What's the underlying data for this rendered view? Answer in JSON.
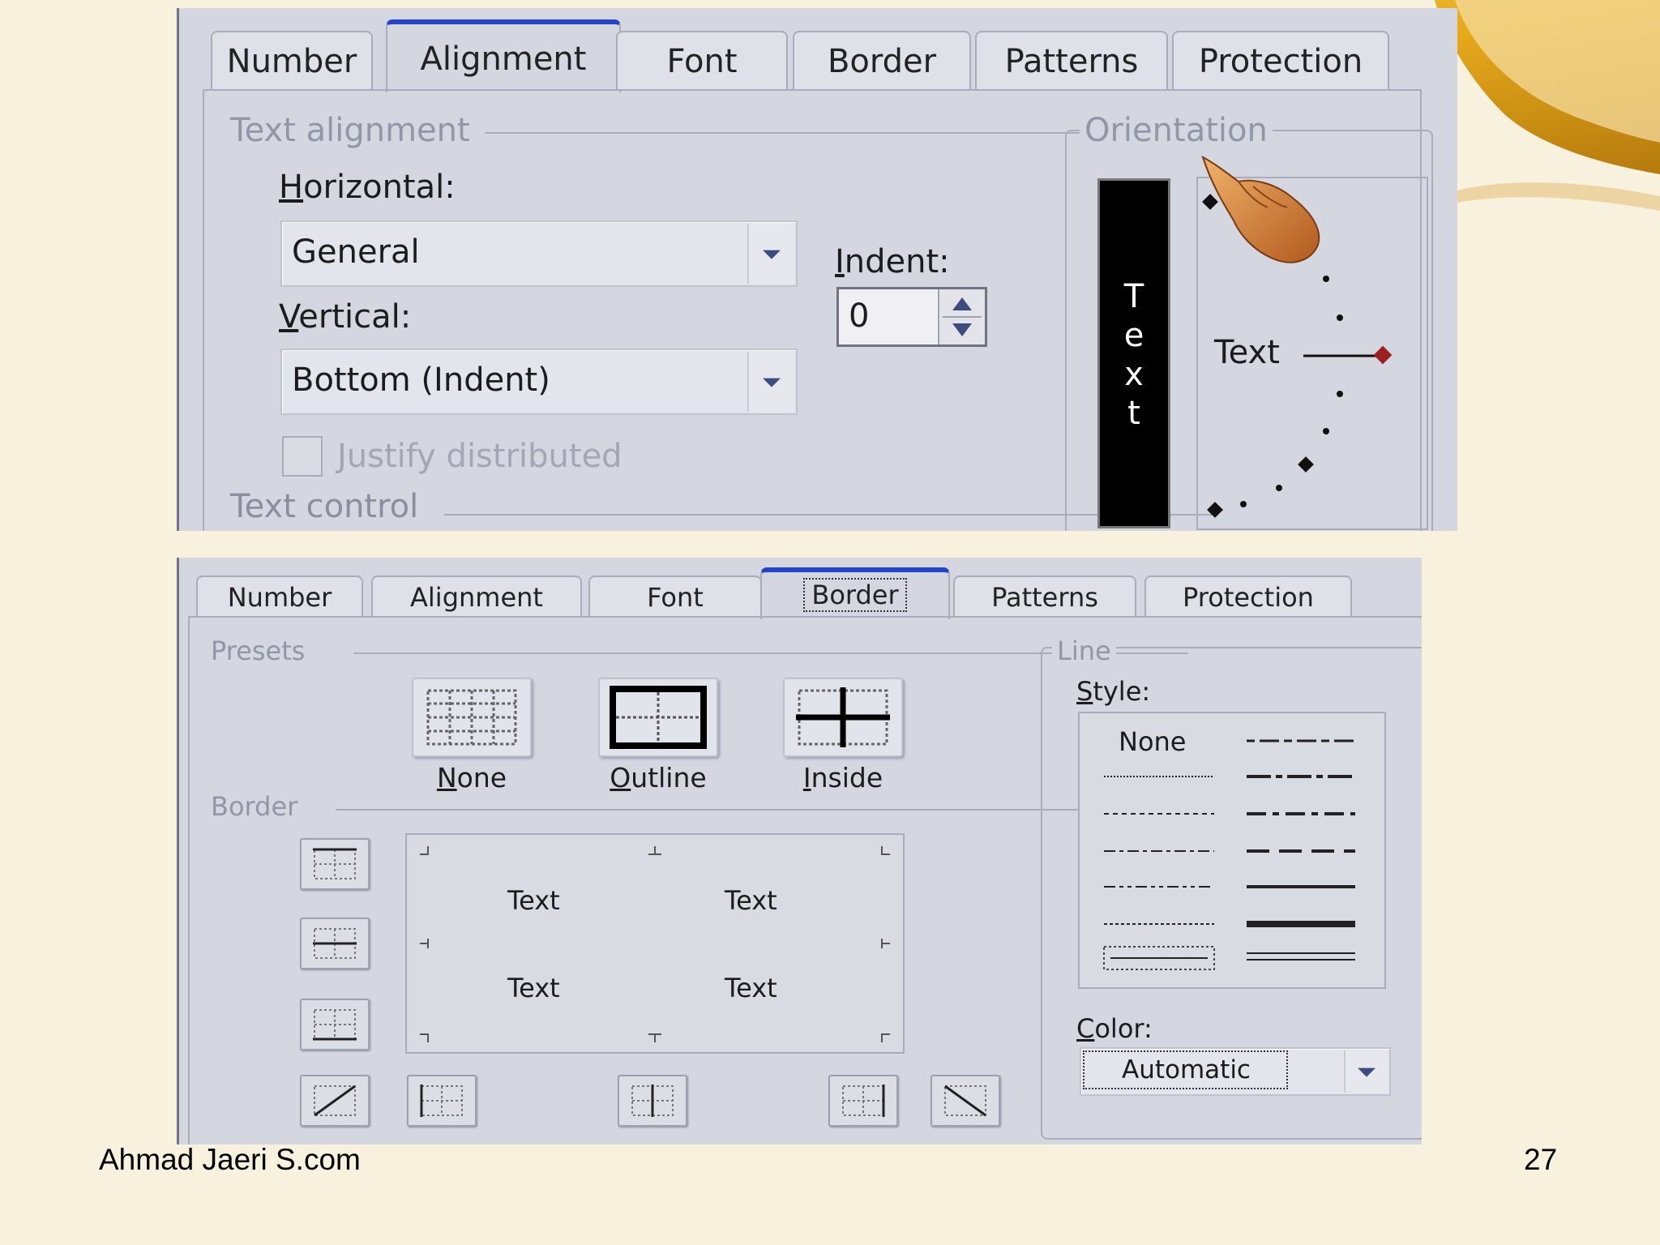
{
  "colors": {
    "slide_bg": "#f8f1de",
    "dialog_bg": "#d4d6e0",
    "active_tab_accent": "#2443c8",
    "group_label": "#9197a8",
    "curl_gold": "#e6b026"
  },
  "footer": {
    "left": "Ahmad Jaeri S.com",
    "page_number": "27"
  },
  "alignment_dialog": {
    "tabs": [
      {
        "label": "Number"
      },
      {
        "label": "Alignment",
        "active": true
      },
      {
        "label": "Font"
      },
      {
        "label": "Border"
      },
      {
        "label": "Patterns"
      },
      {
        "label": "Protection"
      }
    ],
    "text_alignment": {
      "group_label": "Text alignment",
      "horizontal": {
        "label_key": "H",
        "label_rest": "orizontal:",
        "value": "General"
      },
      "vertical": {
        "label_key": "V",
        "label_rest": "ertical:",
        "value": "Bottom (Indent)"
      },
      "indent": {
        "label_key": "I",
        "label_rest": "ndent:",
        "value": "0"
      },
      "justify_distributed": {
        "label": "Justify distributed",
        "checked": false,
        "enabled": false
      }
    },
    "text_control": {
      "group_label": "Text control"
    },
    "orientation": {
      "group_label": "Orientation",
      "vertical_text": [
        "T",
        "e",
        "x",
        "t"
      ],
      "dial_text": "Text",
      "degrees": 0
    },
    "cursor_icon": "hand-pointer-icon"
  },
  "border_dialog": {
    "tabs": [
      {
        "label": "Number"
      },
      {
        "label": "Alignment"
      },
      {
        "label": "Font"
      },
      {
        "label": "Border",
        "active": true
      },
      {
        "label": "Patterns"
      },
      {
        "label": "Protection"
      }
    ],
    "presets": {
      "group_label": "Presets",
      "items": [
        {
          "key": "N",
          "rest": "one",
          "icon": "preset-none-icon"
        },
        {
          "key": "O",
          "rest": "utline",
          "icon": "preset-outline-icon"
        },
        {
          "key": "I",
          "rest": "nside",
          "icon": "preset-inside-icon"
        }
      ]
    },
    "border": {
      "group_label": "Border",
      "preview_text": [
        "Text",
        "Text",
        "Text",
        "Text"
      ]
    },
    "line": {
      "group_label": "Line",
      "style_label_key": "S",
      "style_label_rest": "tyle:",
      "none_label": "None",
      "color_label_key": "C",
      "color_label_rest": "olor:",
      "color_value": "Automatic"
    }
  }
}
